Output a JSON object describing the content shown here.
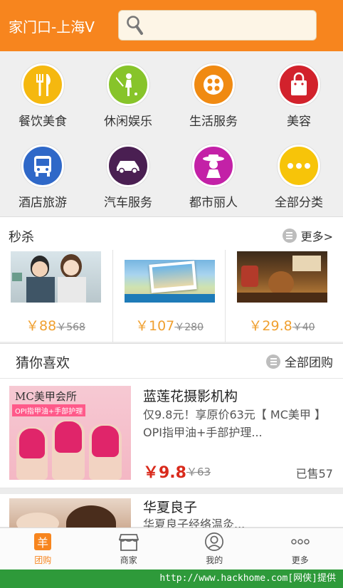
{
  "header": {
    "city": "家门口-上海V",
    "search_placeholder": ""
  },
  "categories": [
    {
      "label": "餐饮美食",
      "icon": "fork-knife-icon",
      "color": "#f5b80f"
    },
    {
      "label": "休闲娱乐",
      "icon": "golfer-icon",
      "color": "#87c42a"
    },
    {
      "label": "生活服务",
      "icon": "film-reel-icon",
      "color": "#f08a12"
    },
    {
      "label": "美容",
      "icon": "shopping-bag-icon",
      "color": "#d2222c"
    },
    {
      "label": "酒店旅游",
      "icon": "bus-icon",
      "color": "#2f68c8"
    },
    {
      "label": "汽车服务",
      "icon": "car-icon",
      "color": "#4a1f52"
    },
    {
      "label": "都市丽人",
      "icon": "lady-hat-icon",
      "color": "#c321a7"
    },
    {
      "label": "全部分类",
      "icon": "more-dots-icon",
      "color": "#f7c409"
    }
  ],
  "flash": {
    "title": "秒杀",
    "more": "更多>",
    "deals": [
      {
        "price": "￥88",
        "old": "￥568"
      },
      {
        "price": "￥107",
        "old": "￥280"
      },
      {
        "price": "￥29.8",
        "old": "￥40"
      }
    ]
  },
  "guess": {
    "title": "猜你喜欢",
    "more": "全部团购",
    "items": [
      {
        "title": "蓝莲花摄影机构",
        "desc": "仅9.8元！享原价63元【 MC美甲 】OPI指甲油+手部护理...",
        "price": "￥9.8",
        "old": "￥63",
        "sold": "已售57",
        "thumb_text": "MC美甲会所",
        "thumb_sub": "OPI指甲油+手部护理"
      },
      {
        "title": "华夏良子",
        "desc": "华夏良子经络温灸..."
      }
    ]
  },
  "nav": [
    {
      "label": "团购",
      "icon": "group-buy-icon"
    },
    {
      "label": "商家",
      "icon": "store-icon"
    },
    {
      "label": "我的",
      "icon": "user-icon"
    },
    {
      "label": "更多",
      "icon": "more-dots-icon"
    }
  ],
  "watermark": "http://www.hackhome.com[网侠]提供"
}
